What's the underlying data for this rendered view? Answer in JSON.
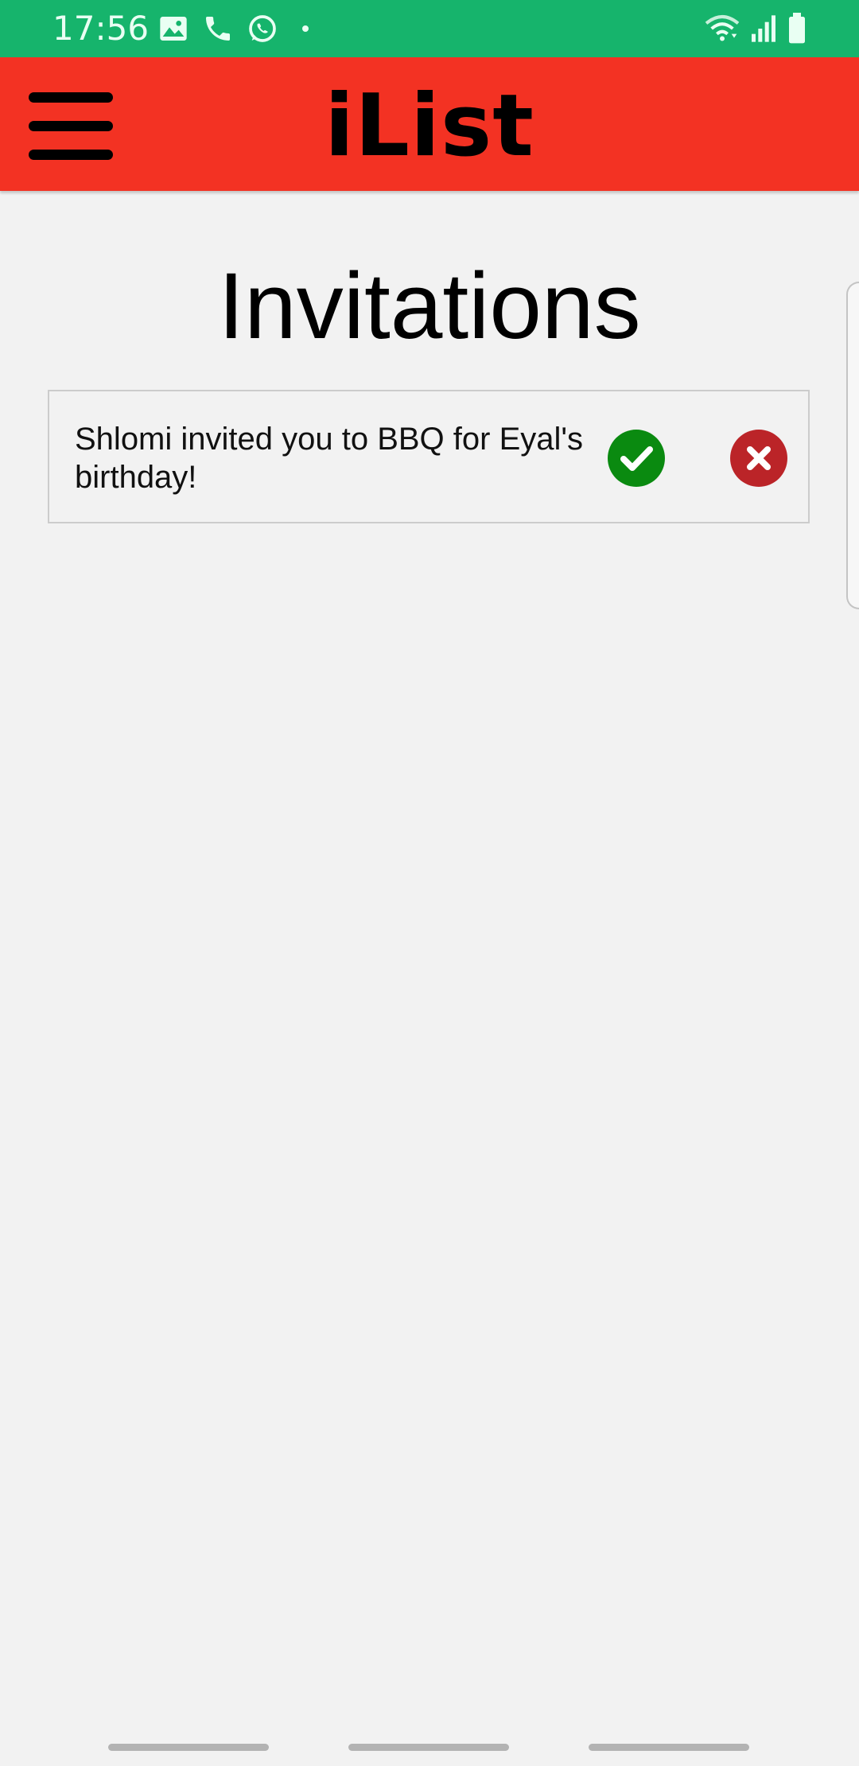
{
  "status_bar": {
    "time": "17:56",
    "bg_color": "#16b46c",
    "left_icons": [
      "image-icon",
      "phone-icon",
      "whatsapp-icon",
      "dot-icon"
    ],
    "right_icons": [
      "wifi-icon",
      "signal-icon",
      "battery-icon"
    ]
  },
  "app_bar": {
    "title": "iList",
    "bg_color": "#f33223",
    "menu_icon": "hamburger-menu-icon"
  },
  "page": {
    "title": "Invitations"
  },
  "invitations": [
    {
      "text": "Shlomi invited you to BBQ for Eyal's birthday!",
      "accept_icon": "check-circle-icon",
      "accept_color": "#0a8a10",
      "decline_icon": "x-circle-icon",
      "decline_color": "#bb2428"
    }
  ]
}
